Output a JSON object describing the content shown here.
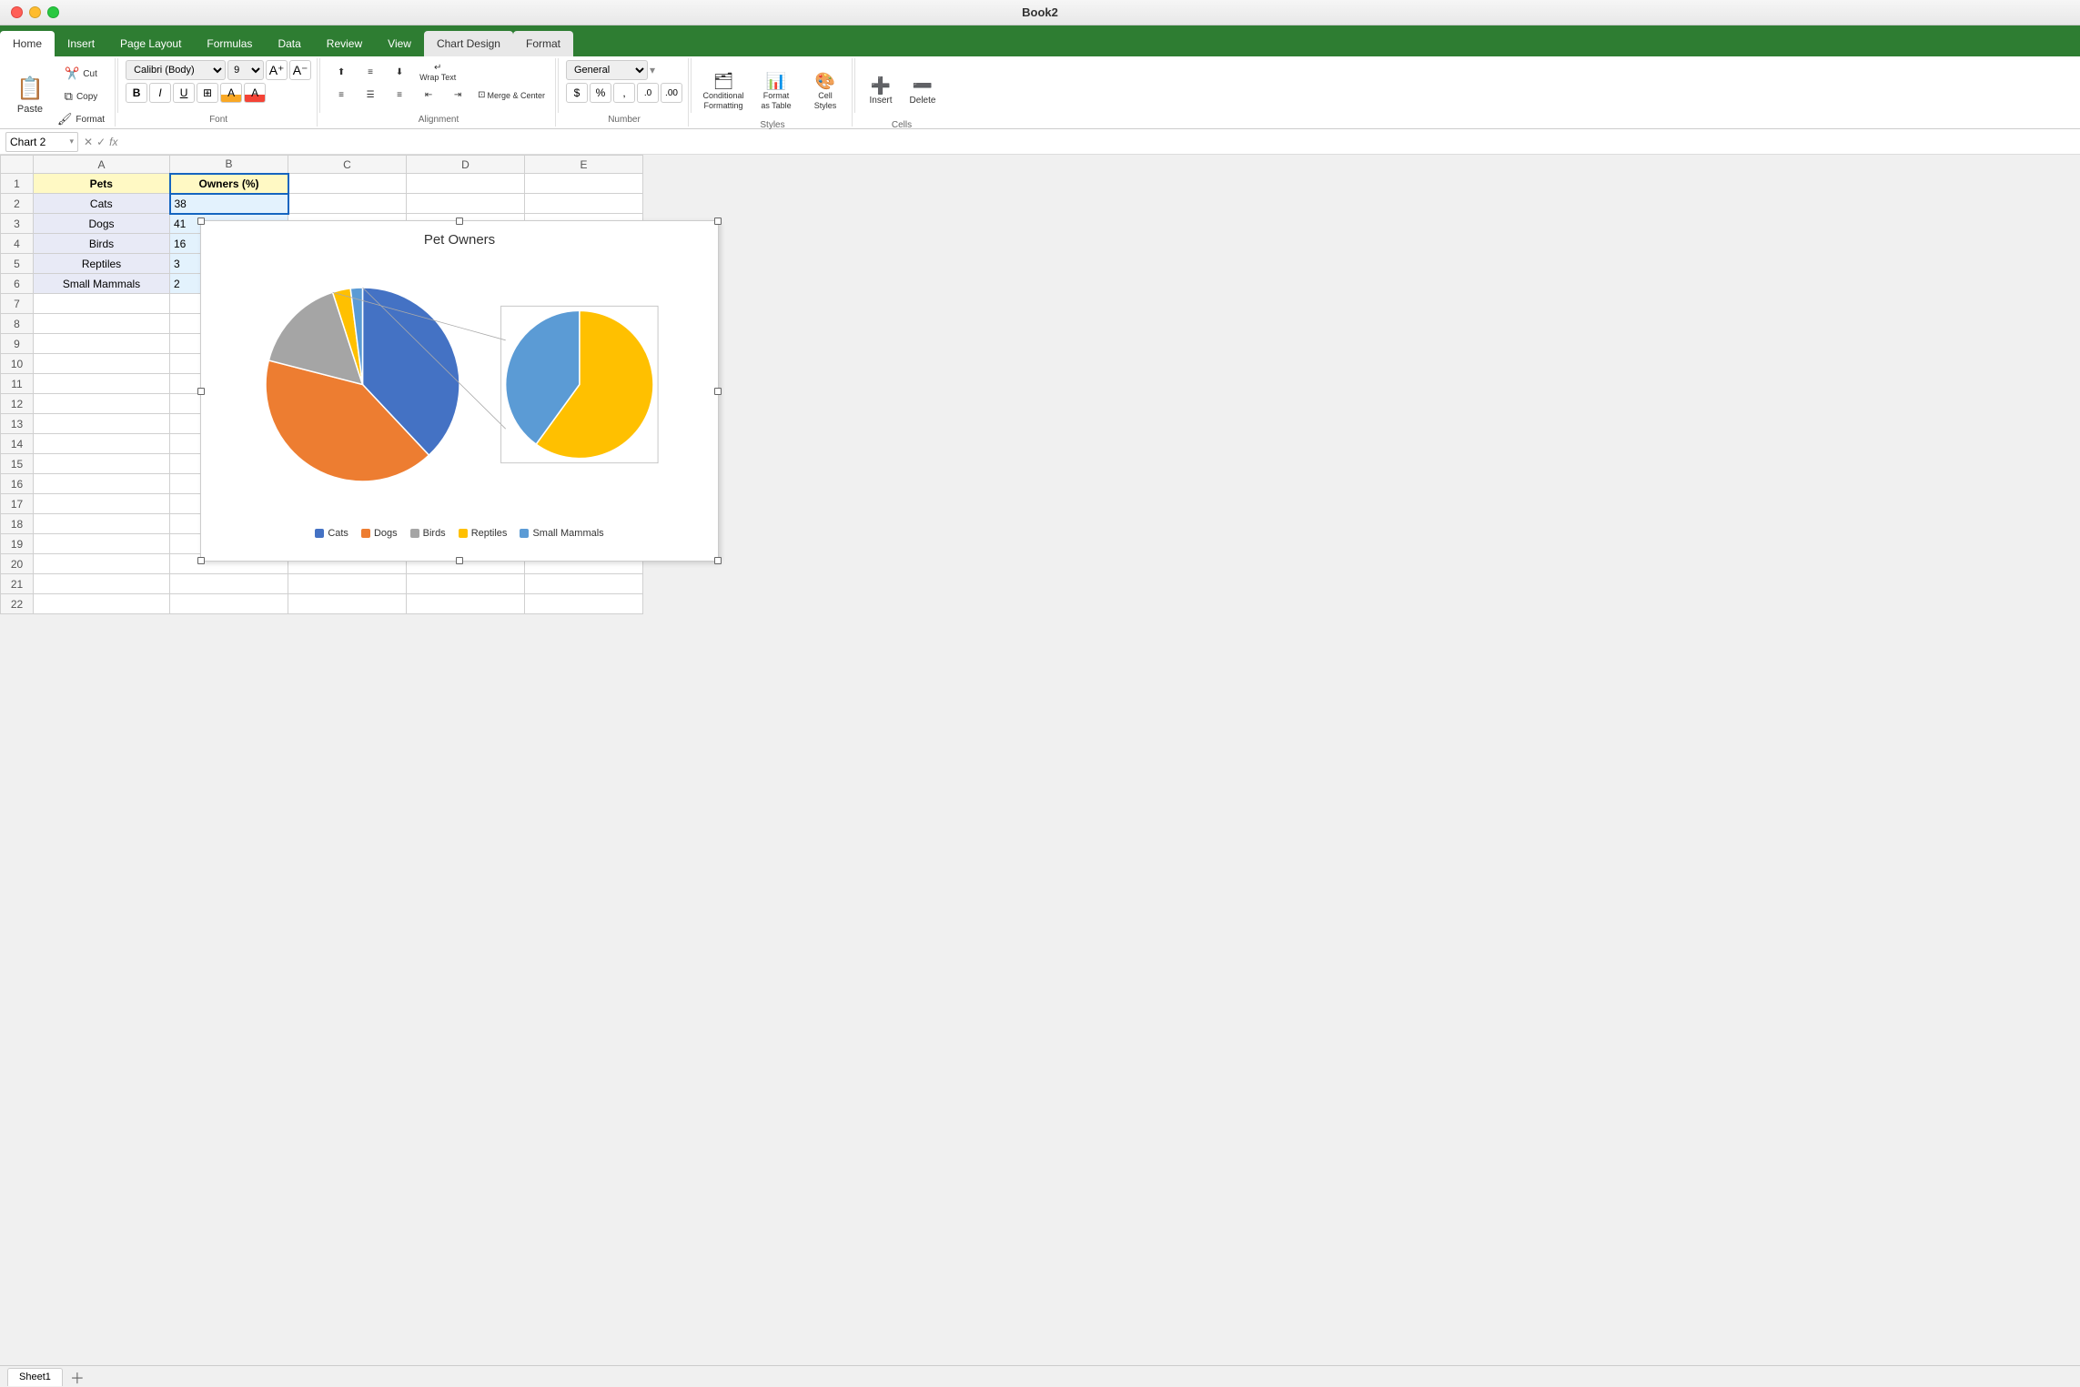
{
  "titleBar": {
    "title": "Book2"
  },
  "tabs": [
    {
      "id": "home",
      "label": "Home",
      "active": true
    },
    {
      "id": "insert",
      "label": "Insert",
      "active": false
    },
    {
      "id": "page-layout",
      "label": "Page Layout",
      "active": false
    },
    {
      "id": "formulas",
      "label": "Formulas",
      "active": false
    },
    {
      "id": "data",
      "label": "Data",
      "active": false
    },
    {
      "id": "review",
      "label": "Review",
      "active": false
    },
    {
      "id": "view",
      "label": "View",
      "active": false
    },
    {
      "id": "chart-design",
      "label": "Chart Design",
      "active": false,
      "special": "chart-design"
    },
    {
      "id": "format",
      "label": "Format",
      "active": false,
      "special": "format-tab"
    }
  ],
  "ribbon": {
    "paste_label": "Paste",
    "cut_label": "Cut",
    "copy_label": "Copy",
    "format_painter_label": "Format",
    "font_name": "Calibri (Body)",
    "font_size": "9",
    "bold_label": "B",
    "italic_label": "I",
    "underline_label": "U",
    "wrap_text_label": "Wrap Text",
    "merge_center_label": "Merge & Center",
    "number_format": "General",
    "conditional_formatting_label": "Conditional\nFormatting",
    "format_as_table_label": "Format\nas Table",
    "cell_styles_label": "Cell\nStyles",
    "insert_label": "Insert",
    "delete_label": "Delete"
  },
  "formulaBar": {
    "nameBox": "Chart 2",
    "formula": ""
  },
  "columns": [
    "A",
    "B",
    "C",
    "D",
    "E"
  ],
  "rows": [
    1,
    2,
    3,
    4,
    5,
    6,
    7,
    8,
    9,
    10,
    11,
    12,
    13,
    14,
    15,
    16,
    17,
    18,
    19,
    20,
    21,
    22
  ],
  "tableData": {
    "headers": [
      "Pets",
      "Owners (%)"
    ],
    "rows": [
      [
        "Cats",
        "38"
      ],
      [
        "Dogs",
        "41"
      ],
      [
        "Birds",
        "16"
      ],
      [
        "Reptiles",
        "3"
      ],
      [
        "Small Mammals",
        "2"
      ]
    ]
  },
  "chart": {
    "title": "Pet Owners",
    "data": [
      {
        "label": "Cats",
        "value": 38,
        "color": "#4472c4"
      },
      {
        "label": "Dogs",
        "value": 41,
        "color": "#ed7d31"
      },
      {
        "label": "Birds",
        "value": 16,
        "color": "#a5a5a5"
      },
      {
        "label": "Reptiles",
        "value": 3,
        "color": "#ffc000"
      },
      {
        "label": "Small Mammals",
        "value": 2,
        "color": "#5b9bd5"
      }
    ]
  },
  "sheetTabs": [
    "Sheet1"
  ]
}
